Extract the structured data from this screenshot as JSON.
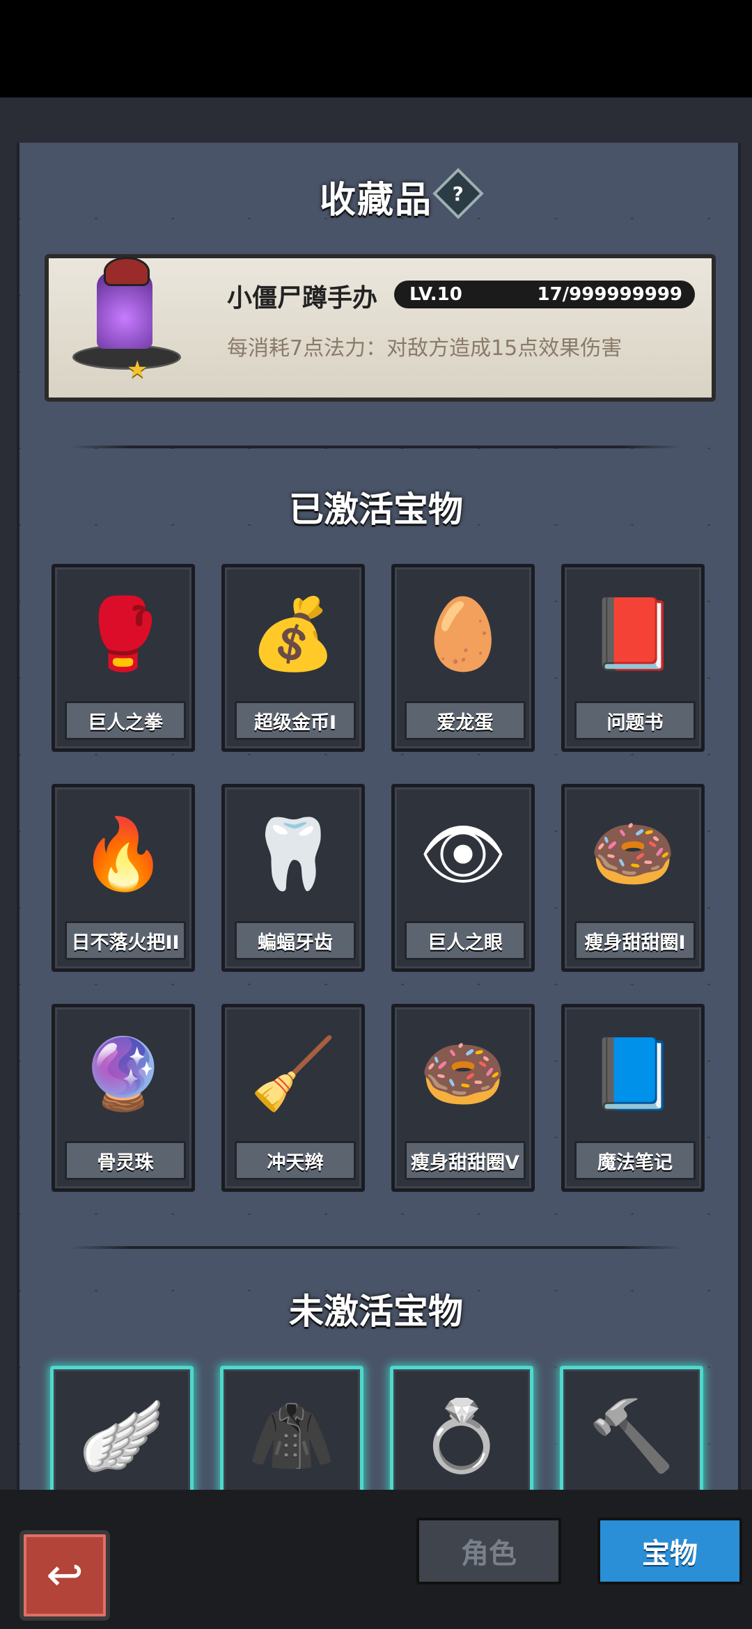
{
  "header": {
    "title": "收藏品",
    "help_icon": "?"
  },
  "featured": {
    "name": "小僵尸蹲手办",
    "level": "LV.10",
    "progress": "17/999999999",
    "description": "每消耗7点法力：对敌方造成15点效果伤害",
    "stars": 1
  },
  "sections": {
    "active_title": "已激活宝物",
    "inactive_title": "未激活宝物"
  },
  "active_items": [
    {
      "label": "巨人之拳",
      "icon": "fist-icon",
      "glyph": "🥊"
    },
    {
      "label": "超级金币I",
      "icon": "coin-icon",
      "glyph": "💰"
    },
    {
      "label": "爱龙蛋",
      "icon": "egg-icon",
      "glyph": "🥚"
    },
    {
      "label": "问题书",
      "icon": "book-icon",
      "glyph": "📕"
    },
    {
      "label": "日不落火把II",
      "icon": "torch-icon",
      "glyph": "🔥"
    },
    {
      "label": "蝙蝠牙齿",
      "icon": "fang-icon",
      "glyph": "🦷"
    },
    {
      "label": "巨人之眼",
      "icon": "eye-icon",
      "glyph": "👁"
    },
    {
      "label": "瘦身甜甜圈I",
      "icon": "donut-icon",
      "glyph": "🍩"
    },
    {
      "label": "骨灵珠",
      "icon": "orb-icon",
      "glyph": "🔮"
    },
    {
      "label": "冲天辫",
      "icon": "braid-icon",
      "glyph": "🧹"
    },
    {
      "label": "瘦身甜甜圈V",
      "icon": "donut-icon",
      "glyph": "🍩"
    },
    {
      "label": "魔法笔记",
      "icon": "spellbook-icon",
      "glyph": "📘"
    }
  ],
  "inactive_items": [
    {
      "icon": "wings-icon",
      "glyph": "🪽"
    },
    {
      "icon": "cloak-icon",
      "glyph": "🧥"
    },
    {
      "icon": "ring-icon",
      "glyph": "💍"
    },
    {
      "icon": "hammer-icon",
      "glyph": "🔨"
    }
  ],
  "nav": {
    "back_glyph": "↩",
    "tab_role": "角色",
    "tab_treasure": "宝物"
  }
}
